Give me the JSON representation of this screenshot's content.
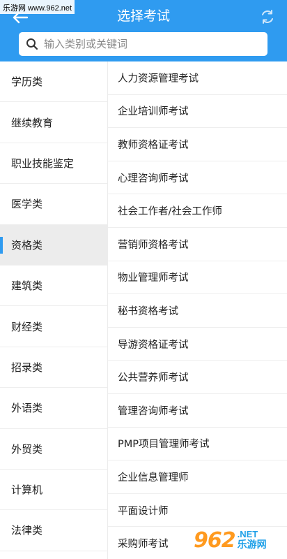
{
  "watermark_top": "乐游网 www.962.net",
  "header": {
    "title": "选择考试",
    "back_icon": "back-arrow-icon",
    "refresh_icon": "refresh-icon",
    "background": "#2f9bf0"
  },
  "search": {
    "placeholder": "输入类别或关键词",
    "value": ""
  },
  "categories": [
    {
      "label": "学历类",
      "active": false
    },
    {
      "label": "继续教育",
      "active": false
    },
    {
      "label": "职业技能鉴定",
      "active": false
    },
    {
      "label": "医学类",
      "active": false
    },
    {
      "label": "资格类",
      "active": true
    },
    {
      "label": "建筑类",
      "active": false
    },
    {
      "label": "财经类",
      "active": false
    },
    {
      "label": "招录类",
      "active": false
    },
    {
      "label": "外语类",
      "active": false
    },
    {
      "label": "外贸类",
      "active": false
    },
    {
      "label": "计算机",
      "active": false
    },
    {
      "label": "法律类",
      "active": false
    }
  ],
  "exams": [
    "人力资源管理考试",
    "企业培训师考试",
    "教师资格证考试",
    "心理咨询师考试",
    "社会工作者/社会工作师",
    "营销师资格考试",
    "物业管理师考试",
    "秘书资格考试",
    "导游资格证考试",
    "公共营养师考试",
    "管理咨询师考试",
    "PMP项目管理师考试",
    "企业信息管理师",
    "平面设计师",
    "采购师考试"
  ],
  "watermark_bottom": {
    "logo": "962",
    "net": ".NET",
    "cn": "乐游网"
  }
}
